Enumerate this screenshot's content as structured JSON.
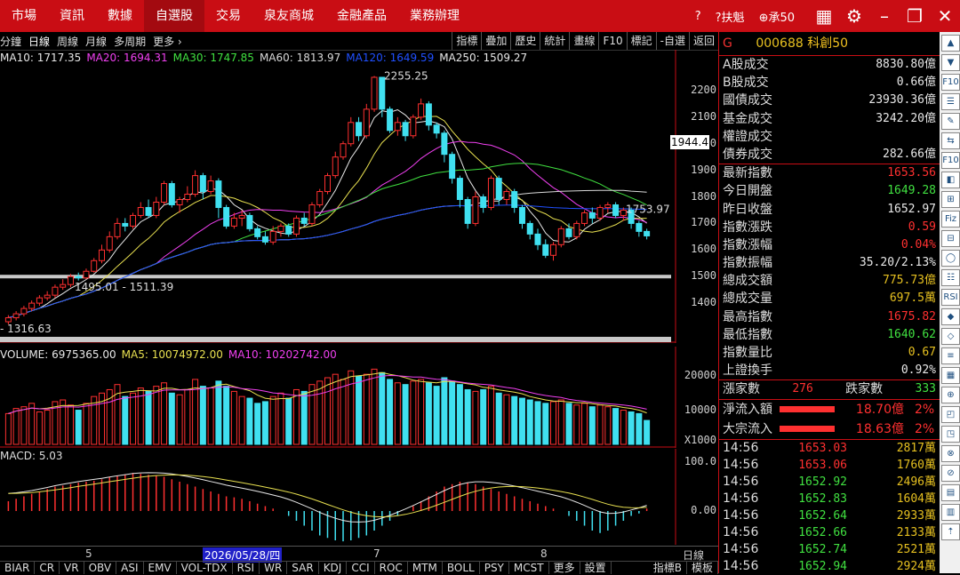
{
  "top_menu": [
    "市場",
    "資訊",
    "數據",
    "自選股",
    "交易",
    "泉友商城",
    "金融產品",
    "業務辦理"
  ],
  "top_menu_active": 3,
  "top_right": {
    "help": "?",
    "user": "?扶魁",
    "order": "⊕承50"
  },
  "toolbar_left": [
    "分鐘",
    "日線",
    "周線",
    "月線",
    "多周期",
    "更多 ›"
  ],
  "toolbar_left_selected": 1,
  "toolbar_right": [
    "指標",
    "疊加",
    "歷史",
    "統計",
    "畫線",
    "F10",
    "標記",
    "-自選",
    "返回"
  ],
  "ma_legend": [
    {
      "text": "MA10: 1717.35",
      "color": "#e8e8e8"
    },
    {
      "text": "MA20: 1694.31",
      "color": "#f040f0"
    },
    {
      "text": "MA30: 1747.85",
      "color": "#40e040"
    },
    {
      "text": "MA60: 1813.97",
      "color": "#d8d8d8"
    },
    {
      "text": "MA120: 1649.59",
      "color": "#2050ff"
    },
    {
      "text": "MA250: 1509.27",
      "color": "#e8e8e8"
    }
  ],
  "annotations": {
    "high": "2255.25",
    "low_pair": "1495.01 - 1511.39",
    "right_label": "1753.97",
    "low_left": "- 1316.63",
    "current": "1944.4"
  },
  "price_ticks": [
    "2200",
    "2100",
    "2000",
    "1900",
    "1800",
    "1700",
    "1600",
    "1500",
    "1400"
  ],
  "vol_legend": [
    {
      "text": "VOLUME: 6975365.00",
      "color": "#e8e8e8"
    },
    {
      "text": "MA5: 10074972.00",
      "color": "#e8e050"
    },
    {
      "text": "MA10: 10202742.00",
      "color": "#f040f0"
    }
  ],
  "vol_ticks": [
    "20000",
    "10000",
    "X1000"
  ],
  "macd_legend": "MACD: 5.03",
  "macd_ticks": [
    "100.0",
    "0.00"
  ],
  "x_axis": {
    "left": "5",
    "date": "2026/05/28/四",
    "mid": "7",
    "right": "8",
    "mode": "日線"
  },
  "bottom_tabs": [
    "BIAR",
    "CR",
    "VR",
    "OBV",
    "ASI",
    "EMV",
    "VOL-TDX",
    "RSI",
    "WR",
    "SAR",
    "KDJ",
    "CCI",
    "ROC",
    "MTM",
    "BOLL",
    "PSY",
    "MCST",
    "更多",
    "設置"
  ],
  "bottom_tabs_right": [
    "指標B",
    "模板"
  ],
  "panel": {
    "code": "000688",
    "name": "科創50",
    "flag": "G",
    "stats": [
      {
        "label": "A股成交",
        "value": "8830.80億",
        "color": "#e8e8e8"
      },
      {
        "label": "B股成交",
        "value": "0.66億",
        "color": "#e8e8e8"
      },
      {
        "label": "國債成交",
        "value": "23930.36億",
        "color": "#e8e8e8"
      },
      {
        "label": "基金成交",
        "value": "3242.20億",
        "color": "#e8e8e8"
      },
      {
        "label": "權證成交",
        "value": "",
        "color": "#e8e8e8"
      },
      {
        "label": "債券成交",
        "value": "282.66億",
        "color": "#e8e8e8"
      }
    ],
    "quote": [
      {
        "label": "最新指數",
        "value": "1653.56",
        "color": "#ff3030"
      },
      {
        "label": "今日開盤",
        "value": "1649.28",
        "color": "#40e040"
      },
      {
        "label": "昨日收盤",
        "value": "1652.97",
        "color": "#e8e8e8"
      },
      {
        "label": "指數漲跌",
        "value": "0.59",
        "color": "#ff3030"
      },
      {
        "label": "指數漲幅",
        "value": "0.04%",
        "color": "#ff3030"
      },
      {
        "label": "指數振幅",
        "value": "35.20/2.13%",
        "color": "#e8e8e8"
      },
      {
        "label": "總成交額",
        "value": "775.73億",
        "color": "#e6c020"
      },
      {
        "label": "總成交量",
        "value": "697.5萬",
        "color": "#e6c020"
      },
      {
        "label": "最高指數",
        "value": "1675.82",
        "color": "#ff3030"
      },
      {
        "label": "最低指數",
        "value": "1640.62",
        "color": "#40e040"
      },
      {
        "label": "指數量比",
        "value": "0.67",
        "color": "#e6c020"
      },
      {
        "label": "上證換手",
        "value": "0.92%",
        "color": "#e8e8e8"
      }
    ],
    "advance": {
      "up_label": "漲家數",
      "up": "276",
      "down_label": "跌家數",
      "down": "333"
    },
    "flows": [
      {
        "label": "淨流入額",
        "value": "18.70億",
        "pct": "2%"
      },
      {
        "label": "大宗流入",
        "value": "18.63億",
        "pct": "2%"
      }
    ],
    "ticks": [
      {
        "time": "14:56",
        "price": "1653.03",
        "vol": "2817萬",
        "color": "#ff3030"
      },
      {
        "time": "14:56",
        "price": "1653.06",
        "vol": "1760萬",
        "color": "#ff3030"
      },
      {
        "time": "14:56",
        "price": "1652.92",
        "vol": "2496萬",
        "color": "#40e040"
      },
      {
        "time": "14:56",
        "price": "1652.83",
        "vol": "1604萬",
        "color": "#40e040"
      },
      {
        "time": "14:56",
        "price": "1652.64",
        "vol": "2933萬",
        "color": "#40e040"
      },
      {
        "time": "14:56",
        "price": "1652.66",
        "vol": "2133萬",
        "color": "#40e040"
      },
      {
        "time": "14:56",
        "price": "1652.74",
        "vol": "2521萬",
        "color": "#40e040"
      },
      {
        "time": "14:56",
        "price": "1652.94",
        "vol": "2924萬",
        "color": "#40e040"
      }
    ]
  },
  "chart_data": {
    "type": "candlestick",
    "ylim": [
      1300,
      2260
    ],
    "candles": [
      [
        1330,
        1345,
        1355,
        1320
      ],
      [
        1345,
        1360,
        1370,
        1335
      ],
      [
        1360,
        1380,
        1390,
        1350
      ],
      [
        1380,
        1400,
        1410,
        1370
      ],
      [
        1400,
        1420,
        1430,
        1390
      ],
      [
        1420,
        1430,
        1445,
        1410
      ],
      [
        1430,
        1460,
        1470,
        1420
      ],
      [
        1460,
        1470,
        1490,
        1450
      ],
      [
        1470,
        1500,
        1510,
        1460
      ],
      [
        1500,
        1495,
        1515,
        1485
      ],
      [
        1495,
        1520,
        1530,
        1490
      ],
      [
        1520,
        1560,
        1570,
        1515
      ],
      [
        1560,
        1600,
        1620,
        1550
      ],
      [
        1600,
        1650,
        1670,
        1590
      ],
      [
        1650,
        1700,
        1720,
        1640
      ],
      [
        1700,
        1690,
        1720,
        1670
      ],
      [
        1690,
        1730,
        1740,
        1680
      ],
      [
        1730,
        1760,
        1780,
        1720
      ],
      [
        1760,
        1730,
        1790,
        1720
      ],
      [
        1730,
        1780,
        1800,
        1720
      ],
      [
        1780,
        1850,
        1860,
        1770
      ],
      [
        1850,
        1770,
        1860,
        1760
      ],
      [
        1770,
        1790,
        1800,
        1740
      ],
      [
        1790,
        1810,
        1840,
        1780
      ],
      [
        1810,
        1880,
        1900,
        1800
      ],
      [
        1880,
        1820,
        1890,
        1790
      ],
      [
        1820,
        1860,
        1880,
        1810
      ],
      [
        1860,
        1760,
        1870,
        1720
      ],
      [
        1760,
        1690,
        1770,
        1680
      ],
      [
        1690,
        1720,
        1740,
        1680
      ],
      [
        1720,
        1730,
        1750,
        1690
      ],
      [
        1730,
        1680,
        1740,
        1670
      ],
      [
        1680,
        1650,
        1690,
        1640
      ],
      [
        1650,
        1630,
        1670,
        1620
      ],
      [
        1630,
        1670,
        1690,
        1620
      ],
      [
        1670,
        1690,
        1700,
        1650
      ],
      [
        1690,
        1660,
        1700,
        1650
      ],
      [
        1660,
        1720,
        1730,
        1650
      ],
      [
        1720,
        1700,
        1740,
        1690
      ],
      [
        1700,
        1770,
        1780,
        1690
      ],
      [
        1770,
        1820,
        1830,
        1760
      ],
      [
        1820,
        1880,
        1890,
        1810
      ],
      [
        1880,
        1950,
        1970,
        1870
      ],
      [
        1950,
        2000,
        2010,
        1940
      ],
      [
        2000,
        2080,
        2100,
        1990
      ],
      [
        2080,
        2030,
        2100,
        2010
      ],
      [
        2030,
        2130,
        2150,
        2020
      ],
      [
        2130,
        2250,
        2255,
        2120
      ],
      [
        2250,
        2130,
        2250,
        2100
      ],
      [
        2130,
        2050,
        2140,
        2040
      ],
      [
        2050,
        2080,
        2100,
        2030
      ],
      [
        2080,
        2030,
        2090,
        2010
      ],
      [
        2030,
        2100,
        2110,
        2020
      ],
      [
        2100,
        2150,
        2170,
        2090
      ],
      [
        2150,
        2070,
        2160,
        2050
      ],
      [
        2070,
        2040,
        2080,
        2020
      ],
      [
        2040,
        1960,
        2050,
        1930
      ],
      [
        1960,
        1870,
        1970,
        1850
      ],
      [
        1870,
        1790,
        1880,
        1760
      ],
      [
        1790,
        1700,
        1800,
        1680
      ],
      [
        1700,
        1800,
        1820,
        1690
      ],
      [
        1800,
        1760,
        1810,
        1740
      ],
      [
        1760,
        1870,
        1880,
        1750
      ],
      [
        1870,
        1790,
        1880,
        1770
      ],
      [
        1790,
        1820,
        1830,
        1770
      ],
      [
        1820,
        1760,
        1830,
        1740
      ],
      [
        1760,
        1700,
        1770,
        1680
      ],
      [
        1700,
        1660,
        1710,
        1640
      ],
      [
        1660,
        1620,
        1680,
        1600
      ],
      [
        1620,
        1580,
        1640,
        1570
      ],
      [
        1580,
        1620,
        1630,
        1560
      ],
      [
        1620,
        1680,
        1690,
        1610
      ],
      [
        1680,
        1650,
        1700,
        1640
      ],
      [
        1650,
        1700,
        1710,
        1640
      ],
      [
        1700,
        1740,
        1750,
        1690
      ],
      [
        1740,
        1720,
        1760,
        1700
      ],
      [
        1720,
        1760,
        1770,
        1710
      ],
      [
        1760,
        1770,
        1780,
        1740
      ],
      [
        1770,
        1730,
        1780,
        1720
      ],
      [
        1730,
        1750,
        1760,
        1710
      ],
      [
        1750,
        1700,
        1760,
        1680
      ],
      [
        1700,
        1670,
        1710,
        1650
      ],
      [
        1670,
        1653,
        1680,
        1640
      ]
    ],
    "volume": [
      9000,
      10500,
      11000,
      12000,
      9500,
      10000,
      12500,
      13000,
      11500,
      10000,
      12000,
      14000,
      15000,
      16000,
      17500,
      14000,
      15000,
      16500,
      15500,
      17000,
      18000,
      15000,
      14500,
      16000,
      19000,
      17000,
      16500,
      18500,
      17000,
      15500,
      14000,
      13500,
      12000,
      12500,
      14000,
      15000,
      13500,
      16000,
      15500,
      17500,
      18500,
      19500,
      20500,
      19000,
      21500,
      20000,
      20500,
      22000,
      21000,
      19000,
      18000,
      17500,
      18500,
      19000,
      18000,
      17000,
      19500,
      18500,
      17500,
      16000,
      15500,
      16000,
      17000,
      15000,
      14500,
      14000,
      13500,
      13000,
      12500,
      12000,
      12500,
      13000,
      12000,
      11500,
      12000,
      11000,
      11500,
      11000,
      10500,
      10000,
      9500,
      9000,
      7000
    ],
    "macd": [
      20,
      25,
      30,
      35,
      40,
      45,
      50,
      52,
      55,
      58,
      60,
      62,
      65,
      70,
      72,
      75,
      78,
      76,
      74,
      72,
      70,
      65,
      60,
      55,
      50,
      45,
      40,
      35,
      30,
      28,
      25,
      20,
      15,
      10,
      5,
      0,
      -10,
      -20,
      -30,
      -40,
      -50,
      -55,
      -60,
      -62,
      -60,
      -55,
      -50,
      -40,
      -30,
      -20,
      -10,
      0,
      10,
      20,
      30,
      40,
      50,
      55,
      60,
      58,
      55,
      50,
      45,
      40,
      35,
      30,
      25,
      20,
      15,
      10,
      5,
      0,
      -10,
      -20,
      -30,
      -40,
      -45,
      -40,
      -30,
      -20,
      -10,
      -5,
      5
    ]
  }
}
